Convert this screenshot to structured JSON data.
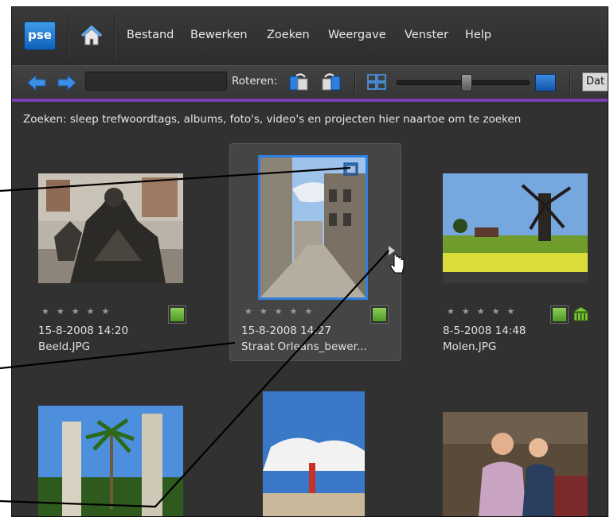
{
  "app": {
    "logo": "pse"
  },
  "menu": [
    "Bestand",
    "Bewerken",
    "Zoeken",
    "Weergave",
    "Venster",
    "Help"
  ],
  "toolbar": {
    "rotate_label": "Roteren:",
    "sort_dropdown": "Dat"
  },
  "hint_text": "Zoeken: sleep trefwoordtags, albums, foto's, video's en projecten hier naartoe om te zoeken",
  "thumbnails": [
    {
      "date": "15-8-2008 14:20",
      "filename": "Beeld.JPG",
      "stars": "★★★★★"
    },
    {
      "date": "15-8-2008 14:27",
      "filename": "Straat Orleans_bewer...",
      "stars": "★★★★★"
    },
    {
      "date": "8-5-2008 14:48",
      "filename": "Molen.JPG",
      "stars": "★★★★★"
    }
  ],
  "colors": {
    "accent_bar": "#7a3fb3",
    "selection": "#2f7fe0",
    "tag_green": "#6cb33a"
  }
}
